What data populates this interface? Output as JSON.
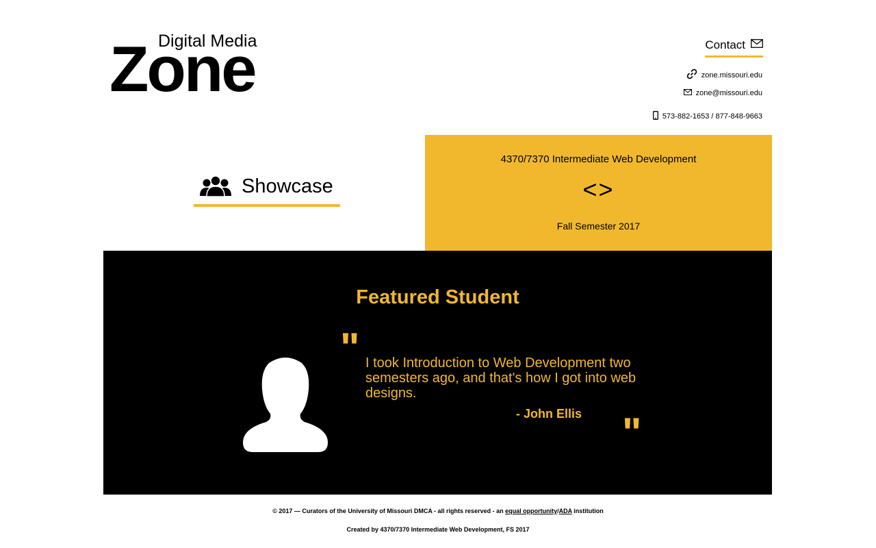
{
  "logo": {
    "subtitle": "Digital Media",
    "title": "Zone"
  },
  "contact": {
    "label": "Contact",
    "website": "zone.missouri.edu",
    "email": "zone@missouri.edu",
    "phone": "573-882-1653 / 877-848-9663"
  },
  "showcase": {
    "label": "Showcase"
  },
  "course": {
    "title": "4370/7370 Intermediate Web Development",
    "code_symbol": "<>",
    "term": "Fall Semester 2017"
  },
  "featured": {
    "heading": "Featured Student",
    "quote_open": "\"",
    "quote_close": "\"",
    "quote": "I took Introduction to Web Development two semesters ago, and that's how I got into web designs.",
    "author": "- John Ellis"
  },
  "footer": {
    "copyright_prefix": "© 2017 — Curators of the University of Missouri DMCA - all rights reserved - an ",
    "link_equal": "equal opportunity",
    "separator": "/",
    "link_ada": "ADA",
    "copyright_suffix": " institution",
    "credits": "Created by 4370/7370 Intermediate Web Development, FS 2017"
  },
  "colors": {
    "accent": "#f1b82d",
    "dark": "#000000",
    "background": "#ffffff"
  },
  "icons": [
    "link-icon",
    "mail-icon",
    "phone-icon",
    "group-icon",
    "avatar-icon"
  ]
}
